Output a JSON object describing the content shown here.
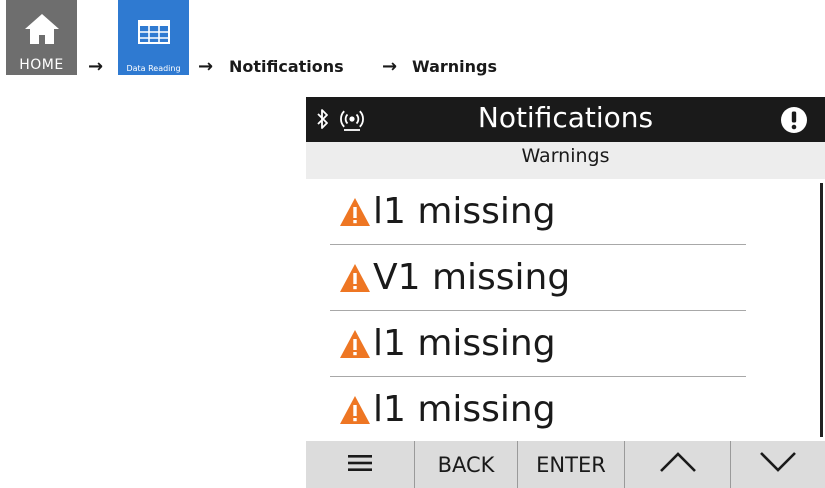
{
  "breadcrumb": {
    "home_label": "HOME",
    "data_reading_label": "Data Reading",
    "arrow": "→",
    "notifications": "Notifications",
    "warnings": "Warnings",
    "home_icon": "house-icon",
    "data_reading_icon": "table-icon",
    "colors": {
      "home_tile": "#6e6e6e",
      "data_tile": "#2f7ad1"
    }
  },
  "screen": {
    "title": "Notifications",
    "subtitle": "Warnings",
    "status_icons": [
      "bluetooth-icon",
      "wireless-icon"
    ],
    "alert_icon": "exclamation-icon",
    "items": [
      {
        "icon": "warning-triangle-icon",
        "label": "l1 missing"
      },
      {
        "icon": "warning-triangle-icon",
        "label": "V1 missing"
      },
      {
        "icon": "warning-triangle-icon",
        "label": "l1 missing"
      },
      {
        "icon": "warning-triangle-icon",
        "label": "l1 missing"
      }
    ],
    "softkeys": {
      "menu_icon": "hamburger-menu-icon",
      "back": "BACK",
      "enter": "ENTER",
      "up_icon": "chevron-up-icon",
      "down_icon": "chevron-down-icon"
    },
    "colors": {
      "title_bar": "#1a1a1a",
      "warning": "#ee7623",
      "sub_bar": "#ededed",
      "bottom_bar": "#dcdcdc"
    }
  }
}
